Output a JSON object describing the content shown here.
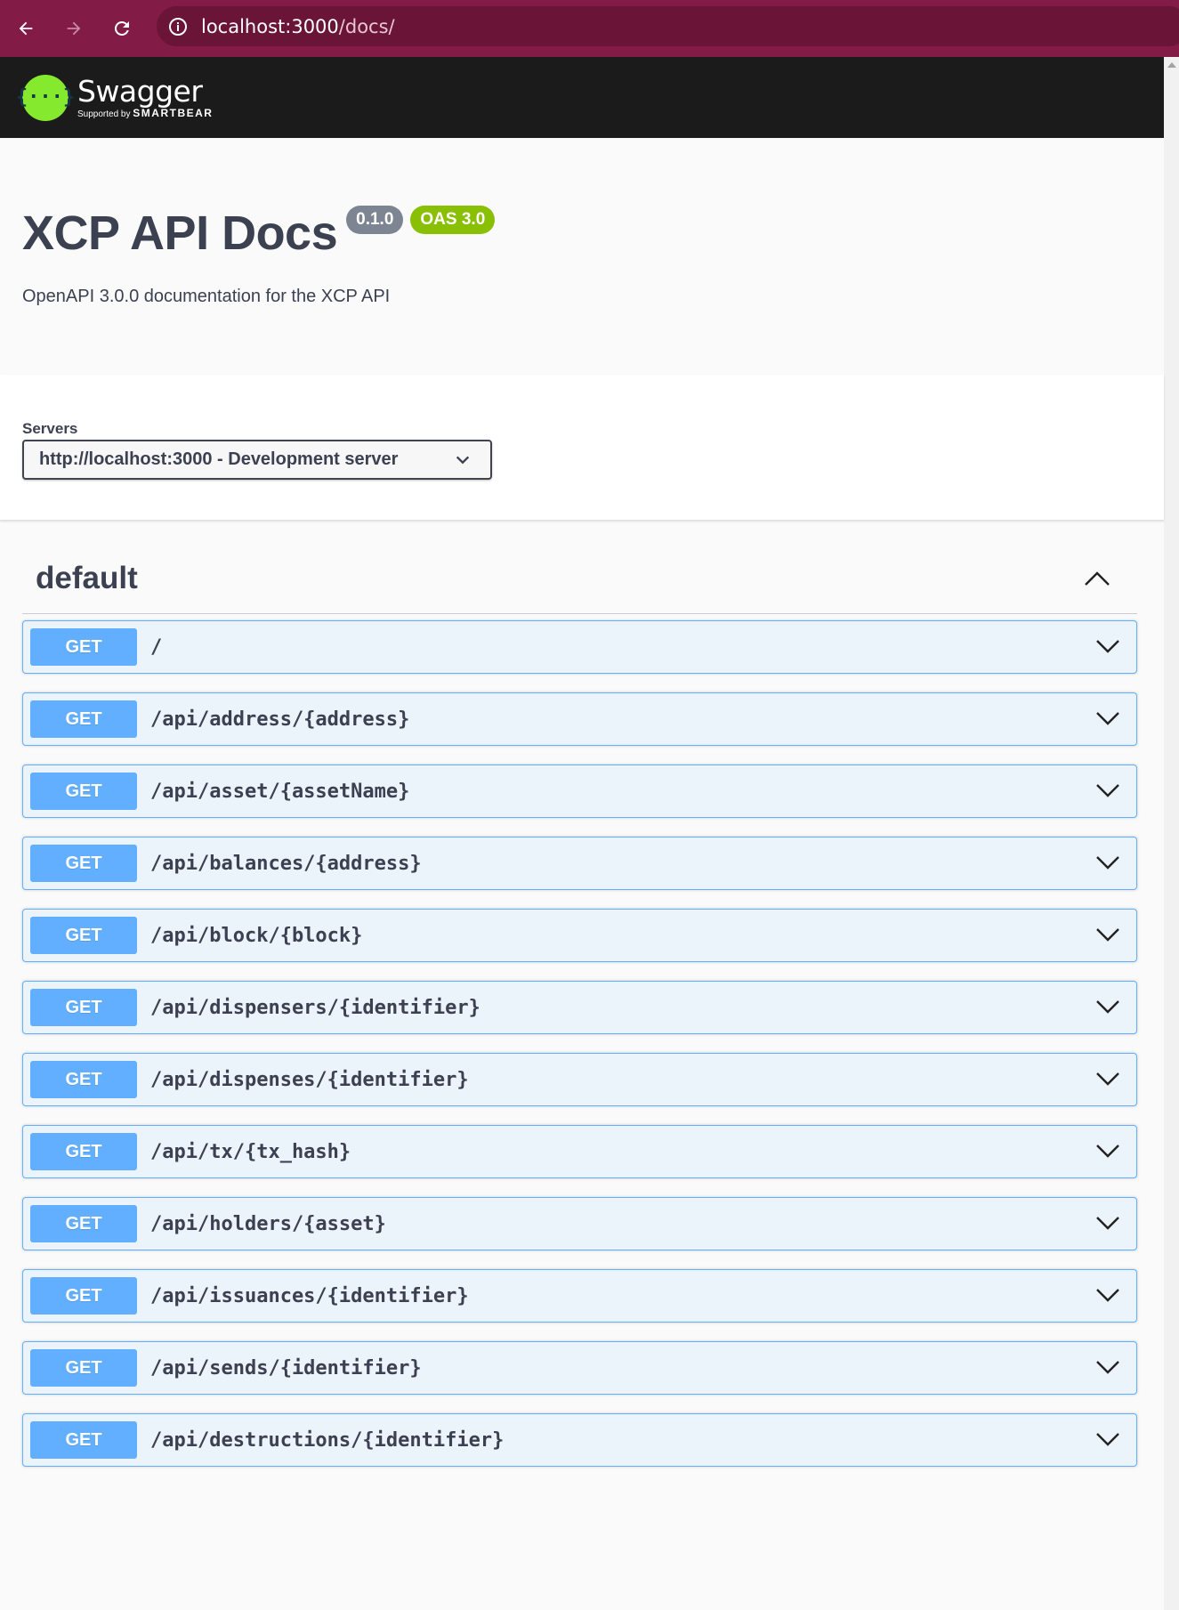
{
  "browser": {
    "url_host": "localhost:3000",
    "url_path": "/docs/"
  },
  "topbar": {
    "logo_name": "Swagger",
    "logo_supported_by": "Supported by",
    "logo_brand": "SMARTBEAR",
    "logo_glyph": "{···}"
  },
  "info": {
    "title": "XCP API Docs",
    "version_badge": "0.1.0",
    "oas_badge": "OAS 3.0",
    "description": "OpenAPI 3.0.0 documentation for the XCP API"
  },
  "servers": {
    "label": "Servers",
    "selected": "http://localhost:3000 - Development server"
  },
  "tag": {
    "name": "default"
  },
  "operations": [
    {
      "method": "GET",
      "path": "/"
    },
    {
      "method": "GET",
      "path": "/api/address/{address}"
    },
    {
      "method": "GET",
      "path": "/api/asset/{assetName}"
    },
    {
      "method": "GET",
      "path": "/api/balances/{address}"
    },
    {
      "method": "GET",
      "path": "/api/block/{block}"
    },
    {
      "method": "GET",
      "path": "/api/dispensers/{identifier}"
    },
    {
      "method": "GET",
      "path": "/api/dispenses/{identifier}"
    },
    {
      "method": "GET",
      "path": "/api/tx/{tx_hash}"
    },
    {
      "method": "GET",
      "path": "/api/holders/{asset}"
    },
    {
      "method": "GET",
      "path": "/api/issuances/{identifier}"
    },
    {
      "method": "GET",
      "path": "/api/sends/{identifier}"
    },
    {
      "method": "GET",
      "path": "/api/destructions/{identifier}"
    }
  ],
  "colors": {
    "browser_bar": "#821b45",
    "swagger_green": "#85ea2d",
    "get_blue": "#61affe",
    "oas_green": "#89bf04"
  }
}
